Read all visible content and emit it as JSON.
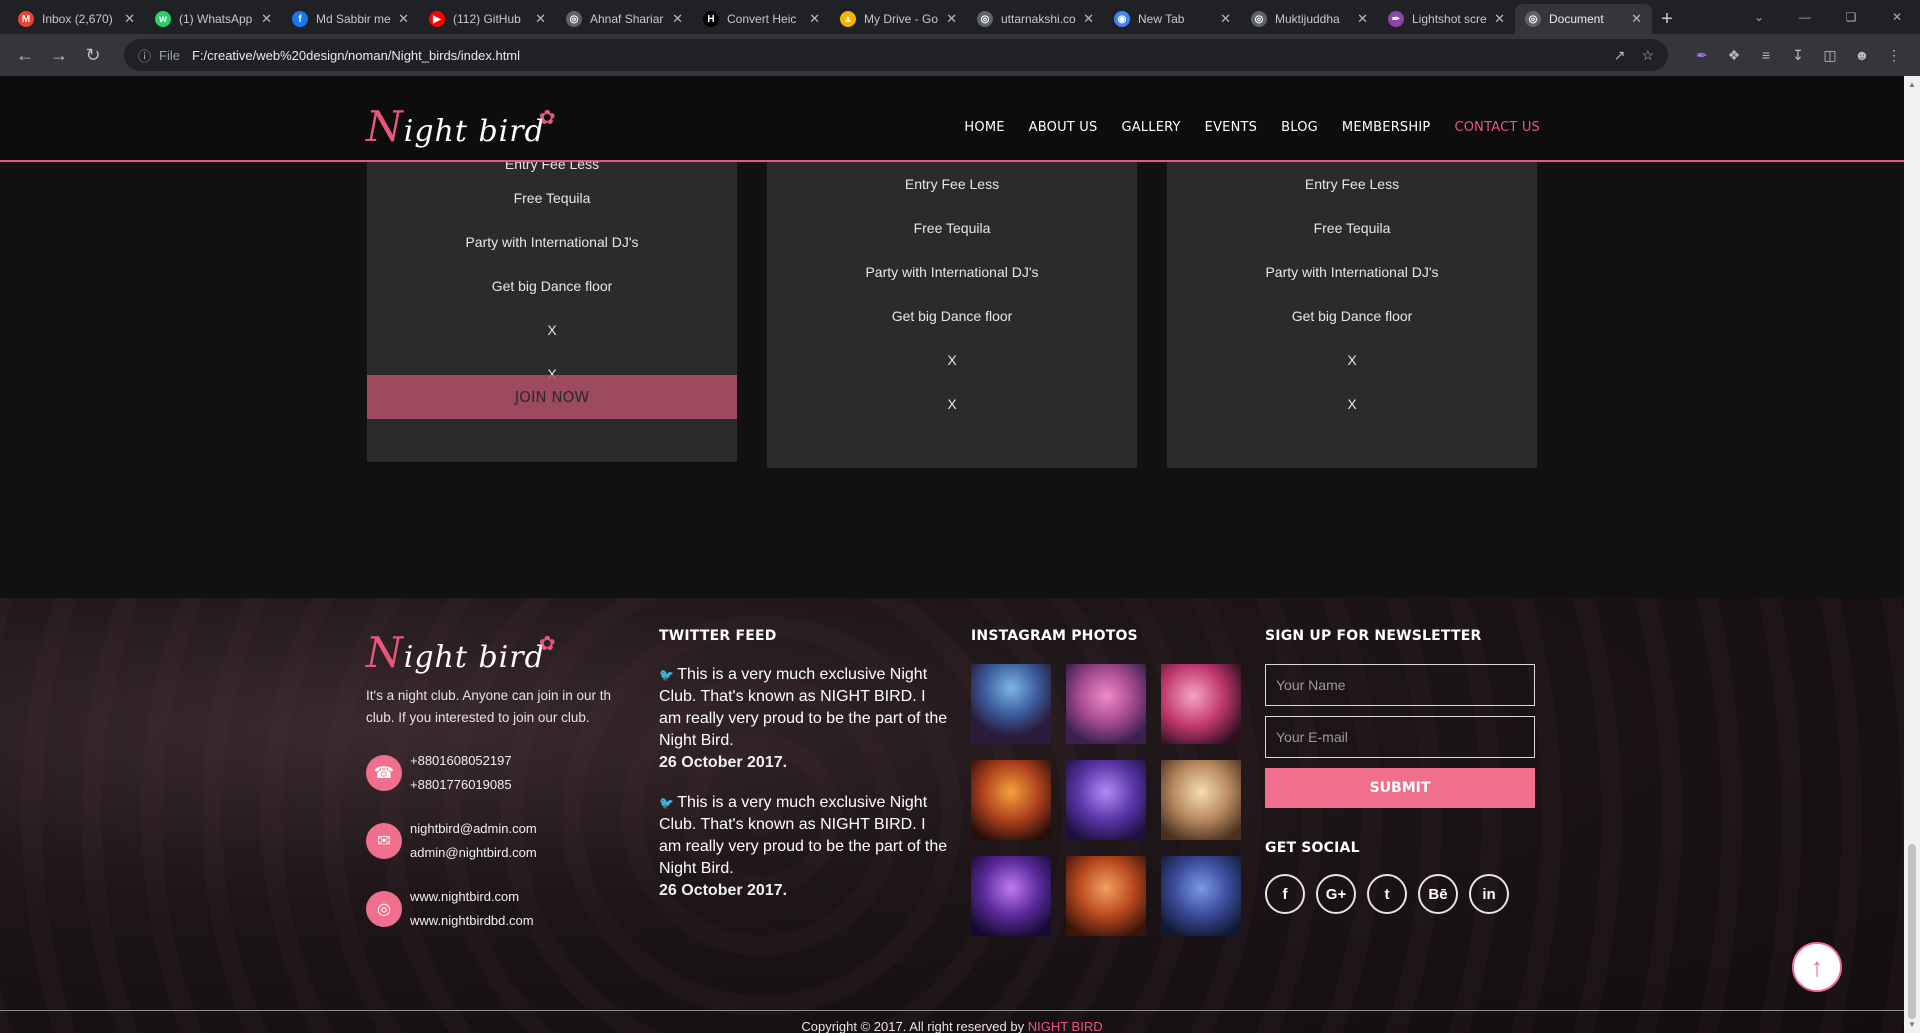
{
  "browser": {
    "tabs": [
      {
        "title": "Inbox (2,670)",
        "icon": "gmail-icon",
        "color": "#ea4335"
      },
      {
        "title": "(1) WhatsApp",
        "icon": "whatsapp-icon",
        "color": "#25d366"
      },
      {
        "title": "Md Sabbir me",
        "icon": "facebook-icon",
        "color": "#1877f2"
      },
      {
        "title": "(112) GitHub",
        "icon": "youtube-icon",
        "color": "#ff0000"
      },
      {
        "title": "Ahnaf Shariar",
        "icon": "globe-icon",
        "color": "#5f6368"
      },
      {
        "title": "Convert Heic",
        "icon": "h-icon",
        "color": "#000000"
      },
      {
        "title": "My Drive - Go",
        "icon": "drive-icon",
        "color": "#f4b400"
      },
      {
        "title": "uttarnakshi.co",
        "icon": "globe-icon",
        "color": "#5f6368"
      },
      {
        "title": "New Tab",
        "icon": "chrome-icon",
        "color": "#4285f4"
      },
      {
        "title": "Muktijuddha",
        "icon": "globe-icon",
        "color": "#5f6368"
      },
      {
        "title": "Lightshot scre",
        "icon": "feather-icon",
        "color": "#8e44ad"
      },
      {
        "title": "Document",
        "icon": "globe-icon",
        "color": "#5f6368"
      }
    ],
    "address": {
      "scheme_label": "File",
      "url": "F:/creative/web%20design/noman/Night_birds/index.html"
    }
  },
  "header": {
    "logo_first": "N",
    "logo_rest": "ight bird",
    "nav": [
      "HOME",
      "ABOUT US",
      "GALLERY",
      "EVENTS",
      "BLOG",
      "MEMBERSHIP",
      "CONTACT US"
    ],
    "active_nav": "CONTACT US"
  },
  "pricing": {
    "cards": [
      {
        "items": [
          "Entry Fee Less",
          "Free Tequila",
          "Party with International DJ's",
          "Get big Dance floor",
          "X",
          "X"
        ],
        "button": "JOIN NOW"
      },
      {
        "items": [
          "Entry Fee Less",
          "Free Tequila",
          "Party with International DJ's",
          "Get big Dance floor",
          "X",
          "X"
        ]
      },
      {
        "items": [
          "Entry Fee Less",
          "Free Tequila",
          "Party with International DJ's",
          "Get big Dance floor",
          "X",
          "X"
        ]
      }
    ]
  },
  "footer": {
    "about": "It's a night club. Anyone can join in our th club. If you interested to join our club.",
    "contacts": [
      {
        "icon": "phone-icon",
        "lines": [
          "+8801608052197",
          "+8801776019085"
        ]
      },
      {
        "icon": "envelope-icon",
        "lines": [
          "nightbird@admin.com",
          "admin@nightbird.com"
        ]
      },
      {
        "icon": "globe-icon",
        "lines": [
          "www.nightbird.com",
          "www.nightbirdbd.com"
        ]
      }
    ],
    "twitter_title": "TWITTER FEED",
    "tweets": [
      {
        "text": "This is a very much exclusive Night Club. That's known as NIGHT BIRD. I am really very proud to be the part of the Night Bird.",
        "date": "26 October 2017."
      },
      {
        "text": "This is a very much exclusive Night Club. That's known as NIGHT BIRD. I am really very proud to be the part of the Night Bird.",
        "date": "26 October 2017."
      }
    ],
    "instagram_title": "INSTAGRAM PHOTOS",
    "newsletter_title": "SIGN UP FOR NEWSLETTER",
    "name_placeholder": "Your Name",
    "email_placeholder": "Your E-mail",
    "submit_label": "SUBMIT",
    "social_title": "GET SOCIAL",
    "social": [
      "f",
      "G+",
      "t",
      "Bē",
      "in"
    ],
    "copyright": "Copyright © 2017. All right reserved by",
    "brand": "NIGHT BIRD"
  },
  "colors": {
    "accent": "#e8577a",
    "card": "#2b2b2b",
    "button": "#ef6f8d"
  }
}
